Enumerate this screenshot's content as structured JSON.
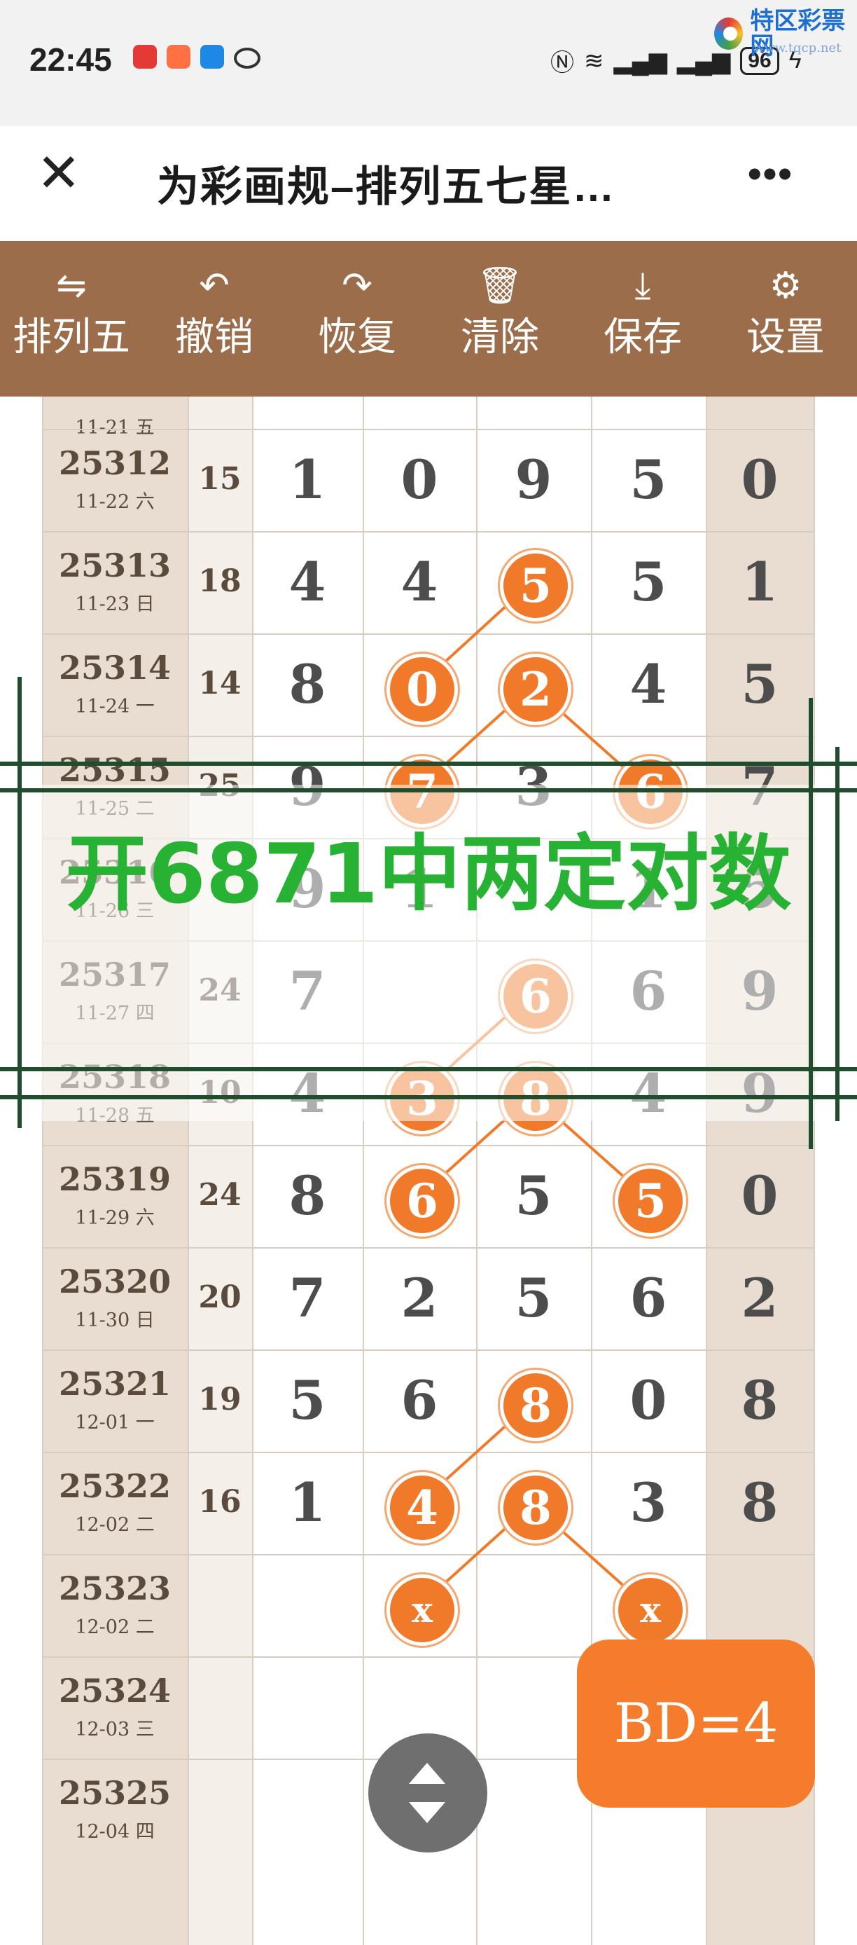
{
  "status_bar": {
    "time": "22:45",
    "battery": "96"
  },
  "watermark": {
    "text": "特区彩票网",
    "url": "www.tqcp.net"
  },
  "nav": {
    "title": "为彩画规–排列五七星…"
  },
  "toolbar": [
    {
      "label": "排列五",
      "icon": "swap-icon",
      "glyph": "⇋"
    },
    {
      "label": "撤销",
      "icon": "undo-icon",
      "glyph": "↶"
    },
    {
      "label": "恢复",
      "icon": "redo-icon",
      "glyph": "↷"
    },
    {
      "label": "清除",
      "icon": "trash-icon",
      "glyph": "🗑"
    },
    {
      "label": "保存",
      "icon": "download-icon",
      "glyph": "⤓"
    },
    {
      "label": "设置",
      "icon": "gear-icon",
      "glyph": "⚙"
    }
  ],
  "partial_top_row": {
    "date": "11-21 五"
  },
  "rows": [
    {
      "id": "25312",
      "date": "11-22 六",
      "sum": "15",
      "digits": [
        "1",
        "0",
        "9",
        "5",
        "0"
      ]
    },
    {
      "id": "25313",
      "date": "11-23 日",
      "sum": "18",
      "digits": [
        "4",
        "4",
        "5",
        "5",
        "1"
      ]
    },
    {
      "id": "25314",
      "date": "11-24 一",
      "sum": "14",
      "digits": [
        "8",
        "0",
        "2",
        "4",
        "5"
      ]
    },
    {
      "id": "25315",
      "date": "11-25 二",
      "sum": "25",
      "digits": [
        "9",
        "7",
        "3",
        "6",
        "7"
      ]
    },
    {
      "id": "25316",
      "date": "11-26 三",
      "sum": "",
      "digits": [
        "9",
        "1",
        "",
        "1",
        "5"
      ]
    },
    {
      "id": "25317",
      "date": "11-27 四",
      "sum": "24",
      "digits": [
        "7",
        "",
        "6",
        "6",
        "9"
      ]
    },
    {
      "id": "25318",
      "date": "11-28 五",
      "sum": "10",
      "digits": [
        "4",
        "3",
        "8",
        "4",
        "9"
      ]
    },
    {
      "id": "25319",
      "date": "11-29 六",
      "sum": "24",
      "digits": [
        "8",
        "6",
        "5",
        "5",
        "0"
      ]
    },
    {
      "id": "25320",
      "date": "11-30 日",
      "sum": "20",
      "digits": [
        "7",
        "2",
        "5",
        "6",
        "2"
      ]
    },
    {
      "id": "25321",
      "date": "12-01 一",
      "sum": "19",
      "digits": [
        "5",
        "6",
        "8",
        "0",
        "8"
      ]
    },
    {
      "id": "25322",
      "date": "12-02 二",
      "sum": "16",
      "digits": [
        "1",
        "4",
        "8",
        "3",
        "8"
      ]
    },
    {
      "id": "25323",
      "date": "12-02 二",
      "sum": "",
      "digits": [
        "",
        "x",
        "",
        "x",
        ""
      ]
    },
    {
      "id": "25324",
      "date": "12-03 三",
      "sum": "",
      "digits": [
        "",
        "",
        "",
        "",
        ""
      ]
    },
    {
      "id": "25325",
      "date": "12-04 四",
      "sum": "",
      "digits": [
        "",
        "",
        "",
        "",
        ""
      ]
    }
  ],
  "headline": "开6871中两定对数",
  "bd_label": "BD=4",
  "colors": {
    "toolbar": "#9c6d4a",
    "circle": "#f07a2a",
    "headline": "#28b233",
    "frame_lines": "#1f4d2e"
  }
}
